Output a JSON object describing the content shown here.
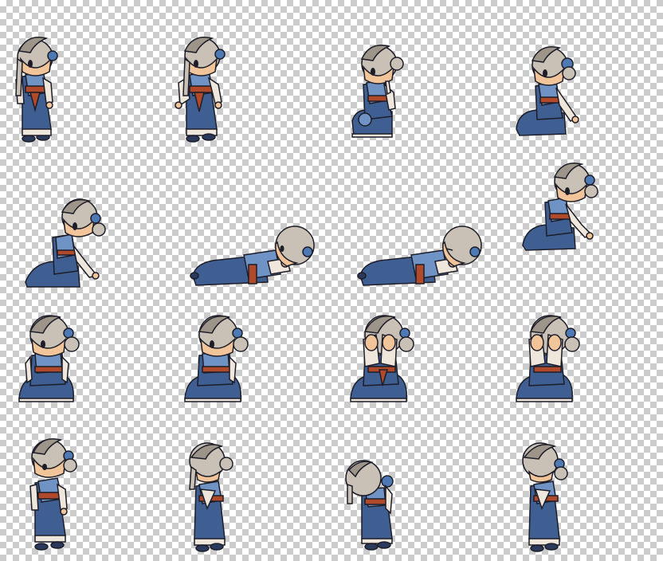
{
  "sprite_sheet": {
    "background": "transparency-checkerboard",
    "colors": {
      "hair": "#c9c1b6",
      "hair_shadow": "#9e958a",
      "skin": "#f2c49a",
      "robe": "#3f5f93",
      "robe_light": "#6f93c4",
      "sash": "#b04a2a",
      "sleeve": "#efe6dc",
      "ribbon": "#4d79b5",
      "outline": "#1d1d28",
      "shoe": "#2b3a5c"
    },
    "rows": [
      [
        "standing-front",
        "standing-three-quarter",
        "kneeling-side",
        "sitting-side"
      ],
      [
        "sitting-lean",
        "lying-down",
        "lying-down-eyes-closed",
        "sitting-side-back"
      ],
      [
        "kneeling-front",
        "kneeling-front-alt",
        "kneeling-face-covered",
        "kneeling-face-covered-alt"
      ],
      [
        "standing-sad",
        "standing-head-bowed",
        "standing-back-view",
        "standing-head-bowed-side"
      ]
    ]
  }
}
